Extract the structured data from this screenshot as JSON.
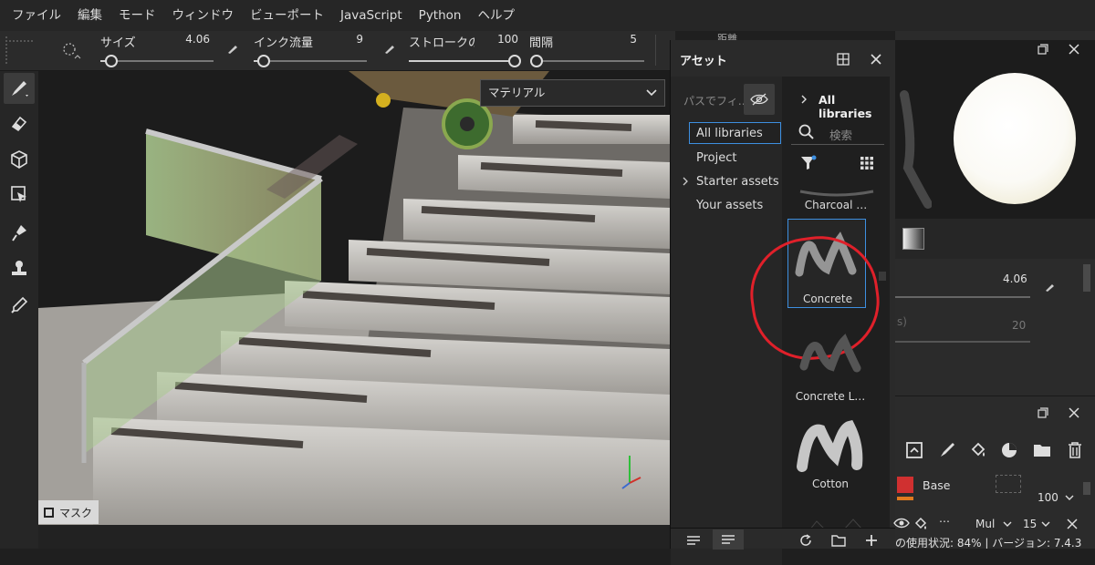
{
  "menu": [
    "ファイル",
    "編集",
    "モード",
    "ウィンドウ",
    "ビューポート",
    "JavaScript",
    "Python",
    "ヘルプ"
  ],
  "tool_options": {
    "size_label": "サイズ",
    "size_value": "4.06",
    "size_fraction": 0.1,
    "flow_label": "インク流量",
    "flow_value": "9",
    "flow_fraction": 0.09,
    "stroke_label": "ストロークのオ",
    "stroke_value": "100",
    "stroke_fraction": 1.0,
    "spacing_label": "間隔",
    "spacing_value": "5",
    "spacing_fraction": 0.05,
    "distance_label": "距離"
  },
  "viewport": {
    "material_dropdown": "マテリアル",
    "mask_label": "マスク"
  },
  "assets": {
    "title": "アセット",
    "filter_placeholder": "パスでフィ…",
    "libraries": [
      "All libraries",
      "Project",
      "Starter assets",
      "Your assets"
    ],
    "selected_library": "All libraries",
    "breadcrumb": "All libraries",
    "search_placeholder": "検索",
    "items": [
      "Charcoal …",
      "Concrete",
      "Concrete L…",
      "Cotton"
    ],
    "selected_item": "Concrete"
  },
  "right_panel": {
    "size_value": "4.06",
    "second_value": "20",
    "second_unit_fragment": "s)",
    "layer_name": "Base",
    "opacity_value": "100",
    "blend_mode": "Mul",
    "blend_value": "15",
    "status_text": "の使用状況: 84% | バージョン: 7.4.3"
  },
  "colors": {
    "accent_blue": "#3d8fe0",
    "annotation_red": "#e0202a",
    "layer_orange": "#e07a1f"
  }
}
